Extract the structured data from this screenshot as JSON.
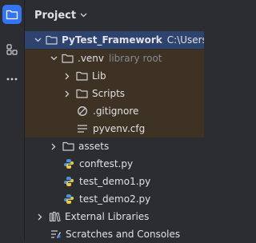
{
  "panel": {
    "title": "Project"
  },
  "tree": {
    "root": {
      "label": "PyTest_Framework",
      "path": "C:\\Users\\y"
    },
    "venv": {
      "label": ".venv",
      "hint": "library root"
    },
    "lib": {
      "label": "Lib"
    },
    "scripts": {
      "label": "Scripts"
    },
    "gitignore": {
      "label": ".gitignore"
    },
    "pyvenv": {
      "label": "pyvenv.cfg"
    },
    "assets": {
      "label": "assets"
    },
    "conftest": {
      "label": "conftest.py"
    },
    "demo1": {
      "label": "test_demo1.py"
    },
    "demo2": {
      "label": "test_demo2.py"
    },
    "external": {
      "label": "External Libraries"
    },
    "scratches": {
      "label": "Scratches and Consoles"
    }
  },
  "colors": {
    "selection": "#2e436e",
    "excluded": "#3d3223",
    "accent": "#3574f0"
  }
}
